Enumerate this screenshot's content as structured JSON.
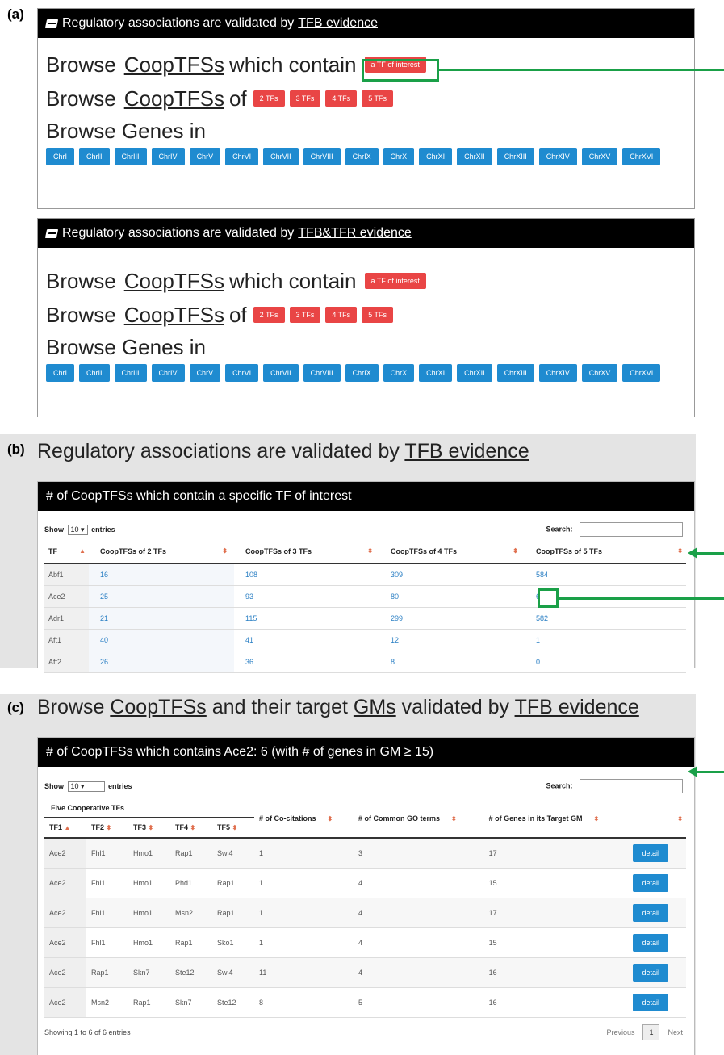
{
  "labels": {
    "a": "(a)",
    "b": "(b)",
    "c": "(c)"
  },
  "section_a": {
    "tfb": {
      "head_text": "Regulatory associations are validated by",
      "head_link": "TFB evidence",
      "line1": {
        "pre": "Browse",
        "link": "CoopTFSs",
        "post": "which contain",
        "btn": "a TF of interest"
      },
      "line2": {
        "pre": "Browse",
        "link": "CoopTFSs",
        "post": "of",
        "btns": [
          "2 TFs",
          "3 TFs",
          "4 TFs",
          "5 TFs"
        ]
      },
      "line3": {
        "text": "Browse Genes in"
      },
      "chr": [
        "ChrI",
        "ChrII",
        "ChrIII",
        "ChrIV",
        "ChrV",
        "ChrVI",
        "ChrVII",
        "ChrVIII",
        "ChrIX",
        "ChrX",
        "ChrXI",
        "ChrXII",
        "ChrXIII",
        "ChrXIV",
        "ChrXV",
        "ChrXVI"
      ]
    },
    "tfr": {
      "head_text": "Regulatory associations are validated by",
      "head_link": "TFB&TFR evidence",
      "line1": {
        "pre": "Browse",
        "link": "CoopTFSs",
        "post": "which contain",
        "btn": "a TF of interest"
      },
      "line2": {
        "pre": "Browse",
        "link": "CoopTFSs",
        "post": "of",
        "btns": [
          "2 TFs",
          "3 TFs",
          "4 TFs",
          "5 TFs"
        ]
      },
      "line3": {
        "text": "Browse Genes in"
      },
      "chr": [
        "ChrI",
        "ChrII",
        "ChrIII",
        "ChrIV",
        "ChrV",
        "ChrVI",
        "ChrVII",
        "ChrVIII",
        "ChrIX",
        "ChrX",
        "ChrXI",
        "ChrXII",
        "ChrXIII",
        "ChrXIV",
        "ChrXV",
        "ChrXVI"
      ]
    }
  },
  "section_b": {
    "title_text": "Regulatory associations are validated by",
    "title_link": "TFB evidence",
    "panel_head": "# of CoopTFSs which contain a specific TF of interest",
    "show": "Show",
    "entries_value": "10",
    "entries": "entries",
    "search": "Search:",
    "columns": [
      "TF",
      "CoopTFSs of 2 TFs",
      "CoopTFSs of 3 TFs",
      "CoopTFSs of 4 TFs",
      "CoopTFSs of 5 TFs"
    ],
    "rows": [
      [
        "Abf1",
        "16",
        "108",
        "309",
        "584"
      ],
      [
        "Ace2",
        "25",
        "93",
        "80",
        "6"
      ],
      [
        "Adr1",
        "21",
        "115",
        "299",
        "582"
      ],
      [
        "Aft1",
        "40",
        "41",
        "12",
        "1"
      ],
      [
        "Aft2",
        "26",
        "36",
        "8",
        "0"
      ]
    ]
  },
  "section_c": {
    "title_pre": "Browse",
    "title_link1": "CoopTFSs",
    "title_mid": "and their target",
    "title_link2": "GMs",
    "title_mid2": "validated by",
    "title_link3": "TFB evidence",
    "panel_head": "# of CoopTFSs which contains Ace2: 6 (with # of genes in GM ≥ 15)",
    "show": "Show",
    "entries_value": "10",
    "entries": "entries",
    "search": "Search:",
    "group_header": "Five Cooperative TFs",
    "tf_cols": [
      "TF1",
      "TF2",
      "TF3",
      "TF4",
      "TF5"
    ],
    "other_cols": [
      "# of Co-citations",
      "# of Common GO terms",
      "# of Genes in its Target GM"
    ],
    "rows": [
      [
        "Ace2",
        "Fhl1",
        "Hmo1",
        "Rap1",
        "Swi4",
        "1",
        "3",
        "17"
      ],
      [
        "Ace2",
        "Fhl1",
        "Hmo1",
        "Phd1",
        "Rap1",
        "1",
        "4",
        "15"
      ],
      [
        "Ace2",
        "Fhl1",
        "Hmo1",
        "Msn2",
        "Rap1",
        "1",
        "4",
        "17"
      ],
      [
        "Ace2",
        "Fhl1",
        "Hmo1",
        "Rap1",
        "Sko1",
        "1",
        "4",
        "15"
      ],
      [
        "Ace2",
        "Rap1",
        "Skn7",
        "Ste12",
        "Swi4",
        "11",
        "4",
        "16"
      ],
      [
        "Ace2",
        "Msn2",
        "Rap1",
        "Skn7",
        "Ste12",
        "8",
        "5",
        "16"
      ]
    ],
    "detail_label": "detail",
    "showing": "Showing 1 to 6 of 6 entries",
    "prev": "Previous",
    "page": "1",
    "next": "Next"
  },
  "colors": {
    "accent_green": "#1aa048",
    "red_button": "#e94545",
    "blue_button": "#1f8bd0",
    "link_blue": "#2a7fc4"
  }
}
